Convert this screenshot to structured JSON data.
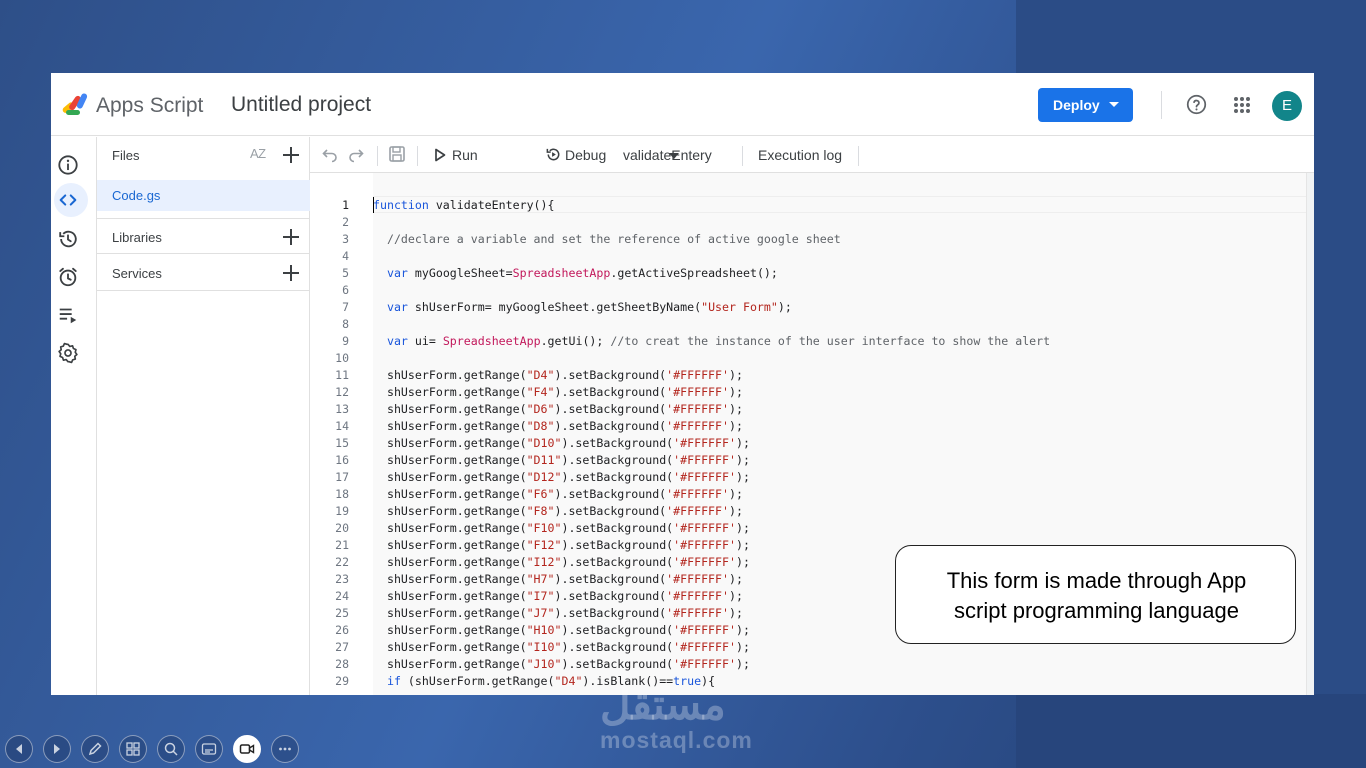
{
  "app": {
    "brand": "Apps Script",
    "project_title": "Untitled project",
    "deploy_label": "Deploy",
    "avatar_letter": "E",
    "colors": {
      "accent": "#1a73e8",
      "avatar": "#12858a",
      "active_bg": "#e8f0fe"
    }
  },
  "rail": {
    "icons": [
      "info-icon",
      "code-icon",
      "history-icon",
      "alarm-icon",
      "executions-icon",
      "settings-icon"
    ],
    "active": "code-icon"
  },
  "files_panel": {
    "files_label": "Files",
    "sort_label": "AZ",
    "file_name": "Code.gs",
    "libraries_label": "Libraries",
    "services_label": "Services"
  },
  "toolbar": {
    "run_label": "Run",
    "debug_label": "Debug",
    "function_select": "validateEntery",
    "execution_log_label": "Execution log"
  },
  "editor": {
    "lines": [
      "function validateEntery(){",
      "",
      "  //declare a variable and set the reference of active google sheet",
      "",
      "  var myGoogleSheet=SpreadsheetApp.getActiveSpreadsheet();",
      "",
      "  var shUserForm= myGoogleSheet.getSheetByName(\"User Form\");",
      "",
      "  var ui= SpreadsheetApp.getUi(); //to creat the instance of the user interface to show the alert",
      "",
      "  shUserForm.getRange(\"D4\").setBackground('#FFFFFF');",
      "  shUserForm.getRange(\"F4\").setBackground('#FFFFFF');",
      "  shUserForm.getRange(\"D6\").setBackground('#FFFFFF');",
      "  shUserForm.getRange(\"D8\").setBackground('#FFFFFF');",
      "  shUserForm.getRange(\"D10\").setBackground('#FFFFFF');",
      "  shUserForm.getRange(\"D11\").setBackground('#FFFFFF');",
      "  shUserForm.getRange(\"D12\").setBackground('#FFFFFF');",
      "  shUserForm.getRange(\"F6\").setBackground('#FFFFFF');",
      "  shUserForm.getRange(\"F8\").setBackground('#FFFFFF');",
      "  shUserForm.getRange(\"F10\").setBackground('#FFFFFF');",
      "  shUserForm.getRange(\"F12\").setBackground('#FFFFFF');",
      "  shUserForm.getRange(\"I12\").setBackground('#FFFFFF');",
      "  shUserForm.getRange(\"H7\").setBackground('#FFFFFF');",
      "  shUserForm.getRange(\"I7\").setBackground('#FFFFFF');",
      "  shUserForm.getRange(\"J7\").setBackground('#FFFFFF');",
      "  shUserForm.getRange(\"H10\").setBackground('#FFFFFF');",
      "  shUserForm.getRange(\"I10\").setBackground('#FFFFFF');",
      "  shUserForm.getRange(\"J10\").setBackground('#FFFFFF');",
      "  if (shUserForm.getRange(\"D4\").isBlank()==true){"
    ],
    "current_line": 1
  },
  "callout": {
    "line1": "This form is made through App",
    "line2": "script programming language"
  },
  "watermark": {
    "arabic": "مستقل",
    "latin": "mostaql.com"
  },
  "presenter_controls": [
    "previous-icon",
    "next-icon",
    "pen-icon",
    "slides-grid-icon",
    "zoom-icon",
    "subtitles-icon",
    "camera-icon",
    "more-icon"
  ]
}
